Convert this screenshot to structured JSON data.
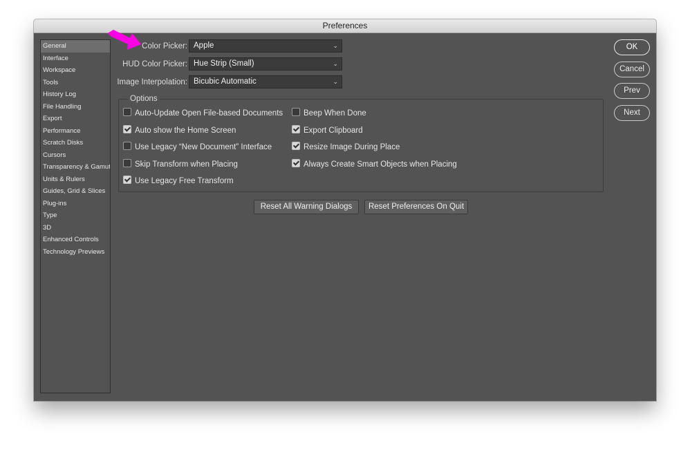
{
  "window": {
    "title": "Preferences"
  },
  "sidebar": {
    "items": [
      {
        "label": "General",
        "selected": true
      },
      {
        "label": "Interface"
      },
      {
        "label": "Workspace"
      },
      {
        "label": "Tools"
      },
      {
        "label": "History Log"
      },
      {
        "label": "File Handling"
      },
      {
        "label": "Export"
      },
      {
        "label": "Performance"
      },
      {
        "label": "Scratch Disks"
      },
      {
        "label": "Cursors"
      },
      {
        "label": "Transparency & Gamut"
      },
      {
        "label": "Units & Rulers"
      },
      {
        "label": "Guides, Grid & Slices"
      },
      {
        "label": "Plug-ins"
      },
      {
        "label": "Type"
      },
      {
        "label": "3D"
      },
      {
        "label": "Enhanced Controls"
      },
      {
        "label": "Technology Previews"
      }
    ]
  },
  "fields": {
    "color_picker": {
      "label": "Color Picker:",
      "value": "Apple"
    },
    "hud_color_picker": {
      "label": "HUD Color Picker:",
      "value": "Hue Strip (Small)"
    },
    "image_interpolation": {
      "label": "Image Interpolation:",
      "value": "Bicubic Automatic"
    }
  },
  "options": {
    "legend": "Options",
    "left": [
      {
        "label": "Auto-Update Open File-based Documents",
        "checked": false
      },
      {
        "label": "Auto show the Home Screen",
        "checked": true
      },
      {
        "label": "Use Legacy “New Document” Interface",
        "checked": false
      },
      {
        "label": "Skip Transform when Placing",
        "checked": false
      },
      {
        "label": "Use Legacy Free Transform",
        "checked": true
      }
    ],
    "right": [
      {
        "label": "Beep When Done",
        "checked": false
      },
      {
        "label": "Export Clipboard",
        "checked": true
      },
      {
        "label": "Resize Image During Place",
        "checked": true
      },
      {
        "label": "Always Create Smart Objects when Placing",
        "checked": true
      }
    ]
  },
  "buttons": {
    "reset_warnings": "Reset All Warning Dialogs",
    "reset_prefs": "Reset Preferences On Quit",
    "ok": "OK",
    "cancel": "Cancel",
    "prev": "Prev",
    "next": "Next"
  },
  "annotation": {
    "icon": "magenta-arrow-icon",
    "color": "#ff00e6"
  },
  "colors": {
    "panel": "#535353",
    "field": "#3b3b3b",
    "accent_arrow": "#ff00e6"
  }
}
